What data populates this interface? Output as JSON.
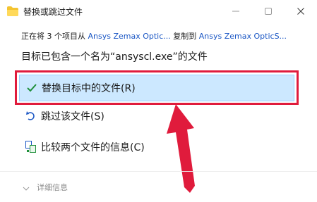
{
  "window": {
    "title": "替换或跳过文件",
    "controls": [
      "minimize",
      "maximize",
      "close"
    ]
  },
  "progress": {
    "prefix": "正在将 3 个项目从",
    "source": "Ansys Zemax Optic...",
    "middle": "复制到",
    "destination": "Ansys Zemax OpticS..."
  },
  "headline": "目标已包含一个名为“ansyscl.exe”的文件",
  "options": [
    {
      "label": "替换目标中的文件(R)",
      "icon": "check-icon",
      "selected": true
    },
    {
      "label": "跳过该文件(S)",
      "icon": "skip-icon",
      "selected": false
    },
    {
      "label": "比较两个文件的信息(C)",
      "icon": "compare-icon",
      "selected": false
    }
  ],
  "details_label": "详细信息",
  "colors": {
    "selection_bg": "#cce8ff",
    "annotation_red": "#e01b3c",
    "link_blue": "#1a56c4",
    "check_green": "#1f8f3a"
  }
}
